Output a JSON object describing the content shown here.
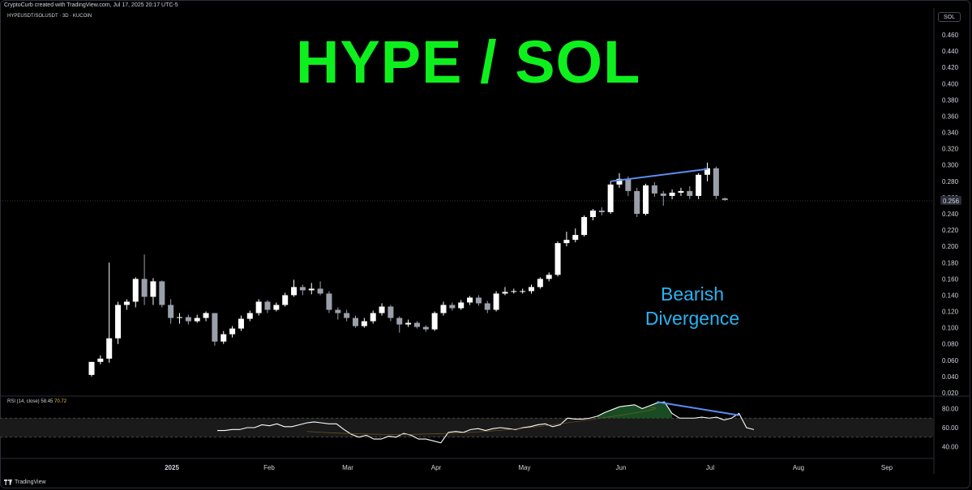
{
  "header": {
    "credit": "CryptoCurb created with TradingView.com, Jul 17, 2025 20:17 UTC-5",
    "symbol": "HYPEUSDT/SOLUSDT · 3D · KUCOIN",
    "symbol_badge": "SOL"
  },
  "title": "HYPE / SOL",
  "annotation": {
    "line1": "Bearish",
    "line2": "Divergence"
  },
  "colors": {
    "title": "#0ef01e",
    "annotation": "#29b3f2",
    "up": "#ffffff",
    "down": "#9aa0aa",
    "divergence": "#5b8def"
  },
  "footer": {
    "logo_icon": "tradingview-logo-icon",
    "brand": "TradingView"
  },
  "chart_data": [
    {
      "type": "candlestick",
      "title": "HYPE / SOL",
      "ylim": [
        0.02,
        0.47
      ],
      "price_ticks": [
        "0.460",
        "0.440",
        "0.420",
        "0.400",
        "0.380",
        "0.360",
        "0.340",
        "0.320",
        "0.300",
        "0.280",
        "0.260",
        "0.240",
        "0.220",
        "0.200",
        "0.180",
        "0.160",
        "0.140",
        "0.120",
        "0.100",
        "0.080",
        "0.060",
        "0.040",
        "0.020"
      ],
      "last_price": "0.256",
      "x_ticks": [
        "2025",
        "Feb",
        "Mar",
        "Apr",
        "May",
        "Jun",
        "Jul",
        "Aug",
        "Sep"
      ],
      "candles": [
        [
          0.042,
          0.058,
          0.058,
          0.04
        ],
        [
          0.058,
          0.062,
          0.066,
          0.055
        ],
        [
          0.062,
          0.087,
          0.18,
          0.057
        ],
        [
          0.087,
          0.128,
          0.132,
          0.08
        ],
        [
          0.128,
          0.132,
          0.135,
          0.122
        ],
        [
          0.132,
          0.16,
          0.162,
          0.125
        ],
        [
          0.16,
          0.138,
          0.19,
          0.128
        ],
        [
          0.138,
          0.157,
          0.161,
          0.128
        ],
        [
          0.157,
          0.128,
          0.158,
          0.125
        ],
        [
          0.128,
          0.112,
          0.135,
          0.105
        ],
        [
          0.112,
          0.113,
          0.118,
          0.105
        ],
        [
          0.113,
          0.108,
          0.116,
          0.104
        ],
        [
          0.108,
          0.112,
          0.116,
          0.106
        ],
        [
          0.112,
          0.118,
          0.12,
          0.108
        ],
        [
          0.118,
          0.083,
          0.118,
          0.078
        ],
        [
          0.083,
          0.092,
          0.096,
          0.08
        ],
        [
          0.092,
          0.099,
          0.102,
          0.088
        ],
        [
          0.099,
          0.111,
          0.115,
          0.096
        ],
        [
          0.111,
          0.118,
          0.121,
          0.108
        ],
        [
          0.118,
          0.132,
          0.135,
          0.115
        ],
        [
          0.132,
          0.122,
          0.134,
          0.118
        ],
        [
          0.122,
          0.128,
          0.131,
          0.12
        ],
        [
          0.128,
          0.14,
          0.143,
          0.126
        ],
        [
          0.14,
          0.15,
          0.159,
          0.138
        ],
        [
          0.15,
          0.146,
          0.153,
          0.14
        ],
        [
          0.146,
          0.148,
          0.155,
          0.141
        ],
        [
          0.148,
          0.142,
          0.157,
          0.14
        ],
        [
          0.142,
          0.122,
          0.145,
          0.118
        ],
        [
          0.122,
          0.118,
          0.125,
          0.11
        ],
        [
          0.118,
          0.112,
          0.122,
          0.108
        ],
        [
          0.112,
          0.102,
          0.115,
          0.1
        ],
        [
          0.102,
          0.108,
          0.112,
          0.1
        ],
        [
          0.108,
          0.118,
          0.121,
          0.105
        ],
        [
          0.118,
          0.126,
          0.13,
          0.115
        ],
        [
          0.126,
          0.112,
          0.128,
          0.108
        ],
        [
          0.112,
          0.104,
          0.114,
          0.094
        ],
        [
          0.104,
          0.106,
          0.11,
          0.101
        ],
        [
          0.106,
          0.101,
          0.108,
          0.099
        ],
        [
          0.101,
          0.098,
          0.103,
          0.095
        ],
        [
          0.098,
          0.118,
          0.12,
          0.096
        ],
        [
          0.118,
          0.128,
          0.132,
          0.115
        ],
        [
          0.128,
          0.124,
          0.131,
          0.121
        ],
        [
          0.124,
          0.131,
          0.134,
          0.122
        ],
        [
          0.131,
          0.137,
          0.139,
          0.128
        ],
        [
          0.137,
          0.13,
          0.14,
          0.127
        ],
        [
          0.13,
          0.122,
          0.133,
          0.118
        ],
        [
          0.122,
          0.142,
          0.145,
          0.12
        ],
        [
          0.142,
          0.144,
          0.15,
          0.14
        ],
        [
          0.144,
          0.145,
          0.148,
          0.142
        ],
        [
          0.145,
          0.145,
          0.148,
          0.142
        ],
        [
          0.145,
          0.15,
          0.153,
          0.142
        ],
        [
          0.15,
          0.16,
          0.162,
          0.148
        ],
        [
          0.16,
          0.165,
          0.168,
          0.157
        ],
        [
          0.165,
          0.204,
          0.206,
          0.163
        ],
        [
          0.204,
          0.208,
          0.218,
          0.2
        ],
        [
          0.208,
          0.214,
          0.222,
          0.205
        ],
        [
          0.214,
          0.236,
          0.238,
          0.212
        ],
        [
          0.236,
          0.244,
          0.246,
          0.232
        ],
        [
          0.244,
          0.242,
          0.248,
          0.238
        ],
        [
          0.242,
          0.276,
          0.28,
          0.24
        ],
        [
          0.276,
          0.283,
          0.29,
          0.272
        ],
        [
          0.283,
          0.268,
          0.286,
          0.262
        ],
        [
          0.268,
          0.24,
          0.272,
          0.236
        ],
        [
          0.24,
          0.275,
          0.277,
          0.238
        ],
        [
          0.275,
          0.265,
          0.279,
          0.261
        ],
        [
          0.265,
          0.262,
          0.268,
          0.25
        ],
        [
          0.262,
          0.266,
          0.27,
          0.258
        ],
        [
          0.266,
          0.268,
          0.272,
          0.262
        ],
        [
          0.268,
          0.262,
          0.274,
          0.258
        ],
        [
          0.262,
          0.288,
          0.29,
          0.258
        ],
        [
          0.288,
          0.296,
          0.303,
          0.28
        ],
        [
          0.296,
          0.262,
          0.298,
          0.258
        ],
        [
          0.259,
          0.257,
          0.26,
          0.256
        ]
      ],
      "divergence_line": {
        "from": [
          59,
          0.28
        ],
        "to": [
          70,
          0.295
        ]
      }
    },
    {
      "type": "line",
      "title": "RSI (14, close)",
      "values_label": [
        "58.45",
        "70.72"
      ],
      "ylim": [
        30,
        95
      ],
      "ticks": [
        "80.00",
        "60.00",
        "40.00"
      ],
      "bands": [
        70,
        50
      ],
      "rsi": [
        57,
        57,
        58,
        58,
        60,
        60,
        63,
        62,
        64,
        61,
        61,
        63,
        65,
        66,
        65,
        64,
        64,
        58,
        53,
        50,
        52,
        48,
        48,
        51,
        50,
        54,
        52,
        48,
        48,
        46,
        44,
        55,
        56,
        55,
        58,
        59,
        57,
        59,
        60,
        59,
        58,
        60,
        61,
        63,
        64,
        61,
        63,
        70,
        69,
        69,
        70,
        72,
        76,
        79,
        82,
        83,
        84,
        80,
        83,
        86,
        87,
        75,
        70,
        70,
        70,
        71,
        70,
        71,
        68,
        70,
        75,
        60,
        58
      ],
      "rsi_ma": [
        null,
        null,
        null,
        null,
        null,
        null,
        null,
        null,
        null,
        null,
        null,
        null,
        null,
        null,
        null,
        null,
        null,
        null,
        null,
        null,
        null,
        null,
        null,
        null,
        null,
        null,
        null,
        null,
        null,
        null,
        null,
        null,
        null,
        null,
        null,
        null,
        null,
        null,
        null,
        null,
        null,
        null,
        null,
        null,
        null,
        null,
        null,
        null,
        null,
        null,
        null,
        null,
        null,
        null,
        null,
        null,
        null,
        null,
        null,
        null,
        null,
        null,
        null,
        null,
        null,
        null,
        null,
        null,
        null,
        null,
        null,
        null,
        null
      ],
      "divergence_line": {
        "from": [
          59,
          87
        ],
        "to": [
          70,
          73
        ]
      }
    }
  ]
}
